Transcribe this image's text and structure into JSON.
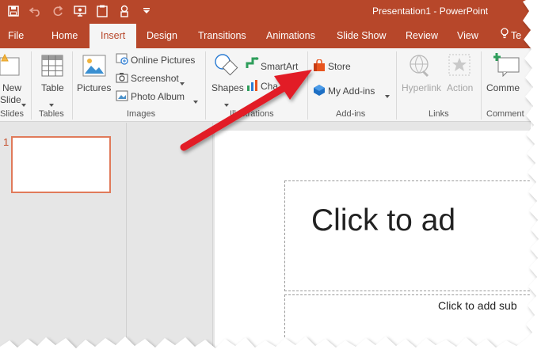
{
  "window": {
    "title": "Presentation1 - PowerPoint"
  },
  "tabs": [
    {
      "label": "File"
    },
    {
      "label": "Home"
    },
    {
      "label": "Insert"
    },
    {
      "label": "Design"
    },
    {
      "label": "Transitions"
    },
    {
      "label": "Animations"
    },
    {
      "label": "Slide Show"
    },
    {
      "label": "Review"
    },
    {
      "label": "View"
    },
    {
      "label": "Te"
    }
  ],
  "ribbon": {
    "slides": {
      "new_slide_line1": "New",
      "new_slide_line2": "Slide",
      "group": "Slides"
    },
    "tables": {
      "table": "Table",
      "group": "Tables"
    },
    "images": {
      "pictures": "Pictures",
      "online_pictures": "Online Pictures",
      "screenshot": "Screenshot",
      "photo_album": "Photo Album",
      "group": "Images"
    },
    "illustrations": {
      "shapes": "Shapes",
      "smartart": "SmartArt",
      "chart": "Cha",
      "group": "Illustrations"
    },
    "addins": {
      "store": "Store",
      "my_addins": "My Add-ins",
      "group": "Add-ins"
    },
    "links": {
      "hyperlink": "Hyperlink",
      "action": "Action",
      "group": "Links"
    },
    "comments": {
      "comment": "Comme",
      "group": "Comment"
    }
  },
  "thumbnails": {
    "slide_number": "1"
  },
  "slide": {
    "title_placeholder": "Click to ad",
    "subtitle_placeholder": "Click to add sub"
  },
  "colors": {
    "accent": "#b7472a",
    "arrow": "#e21f26",
    "store_icon": "#e8541e",
    "addins_icon": "#1e6fc4"
  }
}
